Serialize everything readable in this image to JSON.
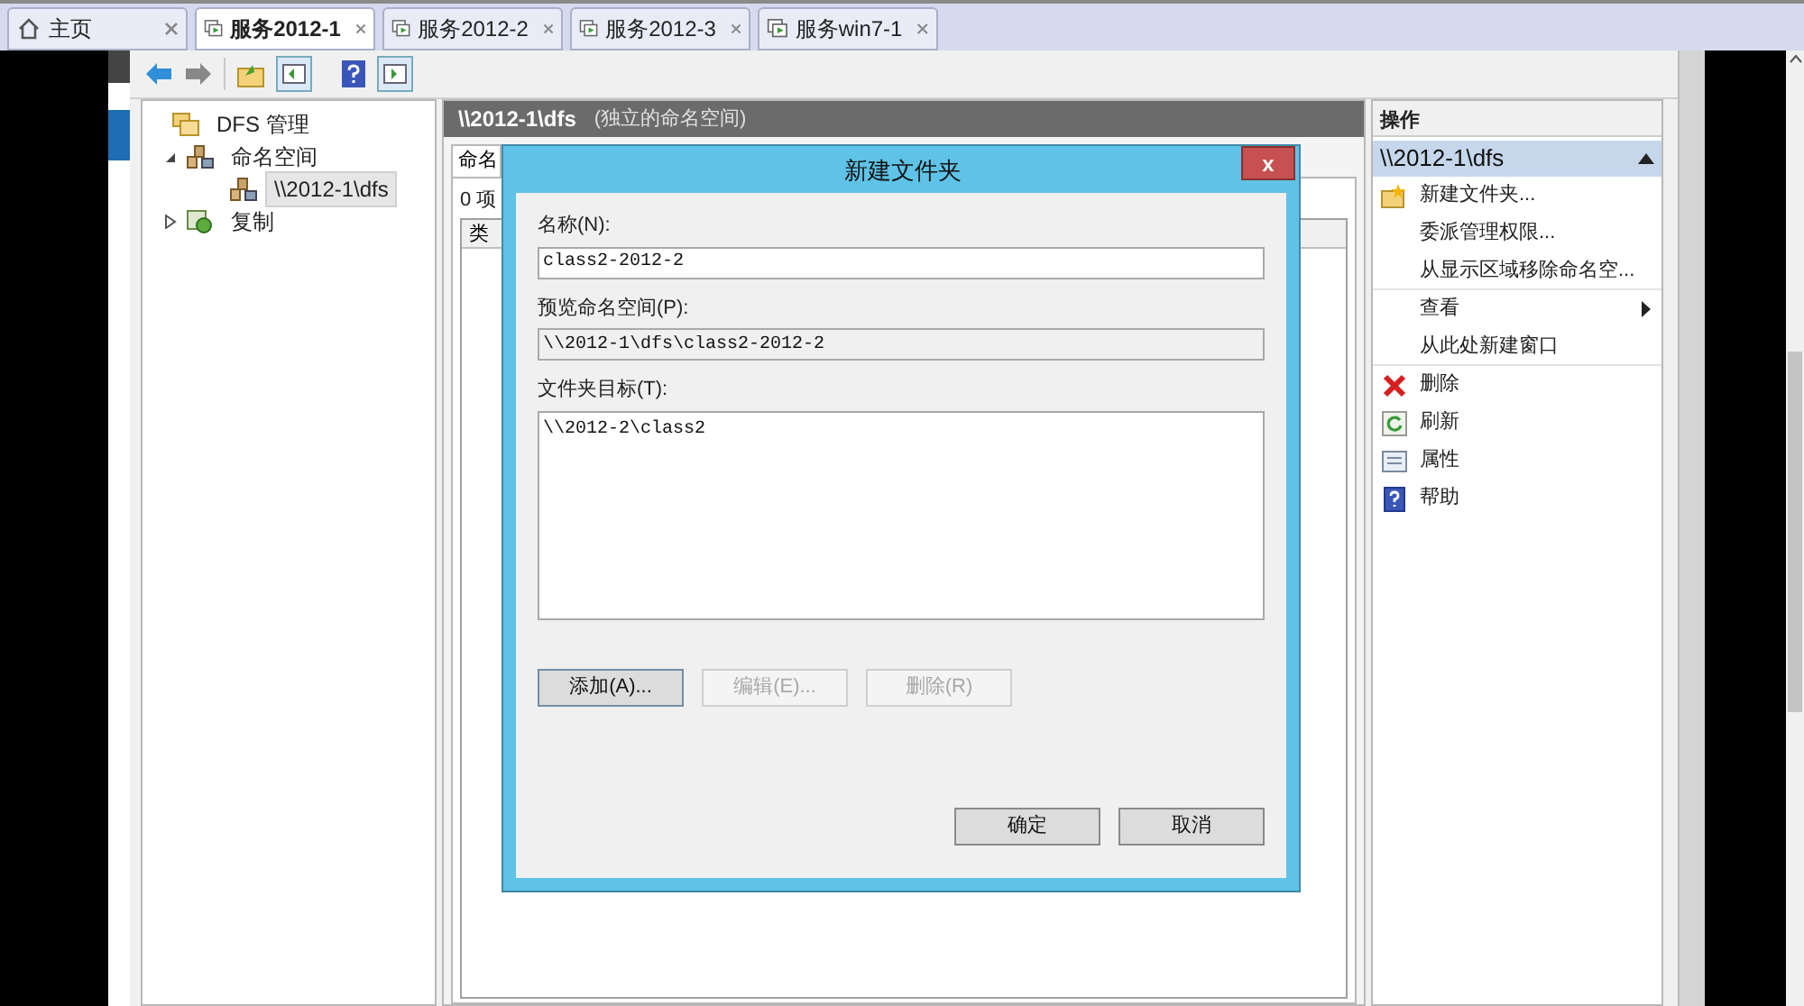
{
  "tabs": [
    {
      "label": "主页",
      "kind": "home",
      "selected": false
    },
    {
      "label": "服务2012-1",
      "kind": "vm",
      "selected": true
    },
    {
      "label": "服务2012-2",
      "kind": "vm",
      "selected": false
    },
    {
      "label": "服务2012-3",
      "kind": "vm",
      "selected": false
    },
    {
      "label": "服务win7-1",
      "kind": "vm",
      "selected": false
    }
  ],
  "tree": [
    {
      "label": "DFS 管理",
      "kind": "dfs",
      "selected": false,
      "children": [
        {
          "label": "命名空间",
          "kind": "namespace",
          "expanded": true,
          "selected": false,
          "children": [
            {
              "label": "\\\\2012-1\\dfs",
              "kind": "namespace",
              "selected": true
            }
          ]
        },
        {
          "label": "复制",
          "kind": "replication",
          "expanded": false,
          "selected": false
        }
      ]
    }
  ],
  "content": {
    "title": "\\\\2012-1\\dfs",
    "subtitle": "(独立的命名空间)",
    "tab": "命名",
    "count": "0 项",
    "column": "类"
  },
  "actions": {
    "header": "操作",
    "section": "\\\\2012-1\\dfs",
    "items": [
      {
        "label": "新建文件夹...",
        "kind": "new-folder",
        "submenu": false,
        "separator_after": false
      },
      {
        "label": "委派管理权限...",
        "kind": "plain",
        "submenu": false,
        "separator_after": false
      },
      {
        "label": "从显示区域移除命名空...",
        "kind": "plain",
        "submenu": false,
        "separator_after": true
      },
      {
        "label": "查看",
        "kind": "plain",
        "submenu": true,
        "separator_after": false
      },
      {
        "label": "从此处新建窗口",
        "kind": "plain",
        "submenu": false,
        "separator_after": true
      },
      {
        "label": "删除",
        "kind": "delete",
        "submenu": false,
        "separator_after": false
      },
      {
        "label": "刷新",
        "kind": "refresh",
        "submenu": false,
        "separator_after": false
      },
      {
        "label": "属性",
        "kind": "properties",
        "submenu": false,
        "separator_after": false
      },
      {
        "label": "帮助",
        "kind": "help",
        "submenu": false,
        "separator_after": false
      }
    ]
  },
  "dialog": {
    "title": "新建文件夹",
    "close": "x",
    "fields": [
      {
        "label": "名称(N):",
        "value": "class2-2012-2",
        "readonly": false
      },
      {
        "label": "预览命名空间(P):",
        "value": "\\\\2012-1\\dfs\\class2-2012-2",
        "readonly": true
      }
    ],
    "targets_label": "文件夹目标(T):",
    "targets": [
      "\\\\2012-2\\class2"
    ],
    "list_buttons": [
      {
        "label": "添加(A)...",
        "disabled": false
      },
      {
        "label": "编辑(E)...",
        "disabled": true
      },
      {
        "label": "删除(R)",
        "disabled": true
      }
    ],
    "buttons": [
      "确定",
      "取消"
    ]
  }
}
